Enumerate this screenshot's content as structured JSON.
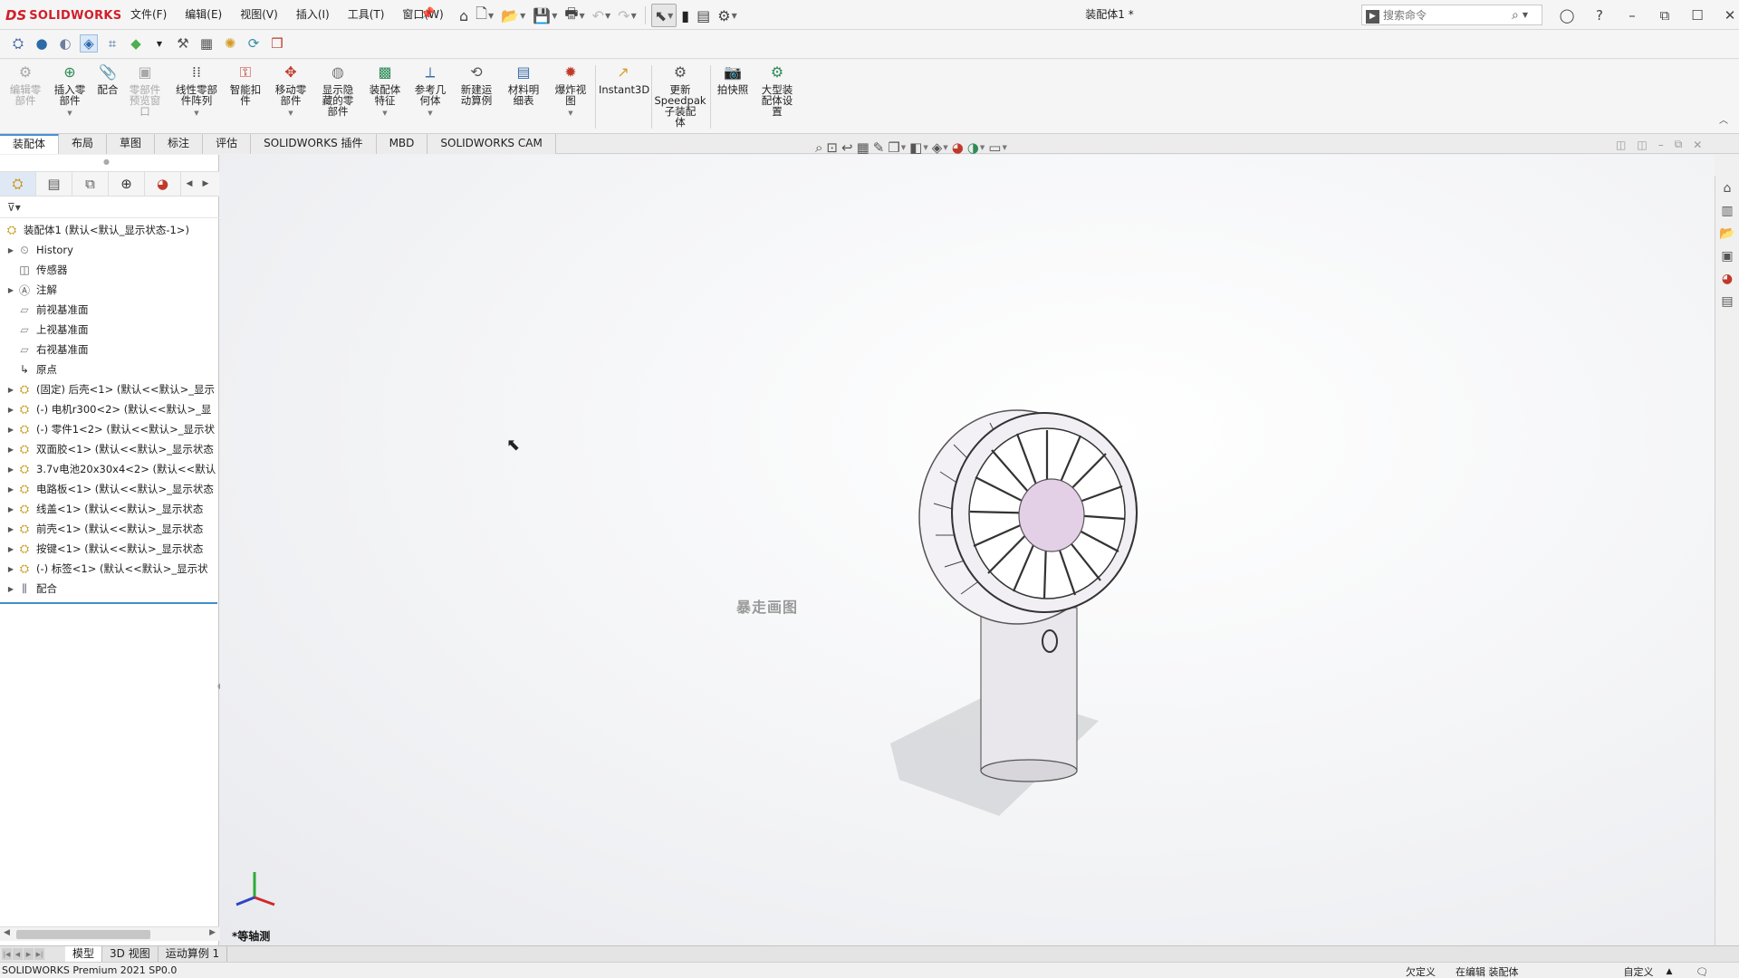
{
  "app": {
    "logo_ds": "DS",
    "logo_text": "SOLIDWORKS",
    "document_title": "装配体1 *",
    "brand_color": "#d11f2a"
  },
  "menu": [
    {
      "label": "文件(F)"
    },
    {
      "label": "编辑(E)"
    },
    {
      "label": "视图(V)"
    },
    {
      "label": "插入(I)"
    },
    {
      "label": "工具(T)"
    },
    {
      "label": "窗口(W)"
    }
  ],
  "search": {
    "placeholder": "搜索命令"
  },
  "commands": [
    {
      "label": "编辑零\n部件",
      "icon": "edit-component-icon",
      "enabled": false
    },
    {
      "label": "插入零\n部件",
      "icon": "insert-component-icon",
      "enabled": true
    },
    {
      "label": "配合",
      "icon": "mate-icon",
      "enabled": true
    },
    {
      "label": "零部件\n预览窗\n口",
      "icon": "component-preview-icon",
      "enabled": false
    },
    {
      "label": "线性零部\n件阵列",
      "icon": "linear-pattern-icon",
      "enabled": true
    },
    {
      "label": "智能扣\n件",
      "icon": "smart-fastener-icon",
      "enabled": true
    },
    {
      "label": "移动零\n部件",
      "icon": "move-component-icon",
      "enabled": true
    },
    {
      "label": "显示隐\n藏的零\n部件",
      "icon": "show-hidden-icon",
      "enabled": true
    },
    {
      "label": "装配体\n特征",
      "icon": "assembly-feature-icon",
      "enabled": true
    },
    {
      "label": "参考几\n何体",
      "icon": "reference-geometry-icon",
      "enabled": true
    },
    {
      "label": "新建运\n动算例",
      "icon": "new-motion-study-icon",
      "enabled": true
    },
    {
      "label": "材料明\n细表",
      "icon": "bom-icon",
      "enabled": true
    },
    {
      "label": "爆炸视\n图",
      "icon": "exploded-view-icon",
      "enabled": true
    },
    {
      "label": "Instant3D",
      "icon": "instant3d-icon",
      "enabled": true
    },
    {
      "label": "更新\nSpeedpak\n子装配\n体",
      "icon": "speedpak-icon",
      "enabled": true
    },
    {
      "label": "拍快照",
      "icon": "snapshot-icon",
      "enabled": true
    },
    {
      "label": "大型装\n配体设\n置",
      "icon": "large-assembly-icon",
      "enabled": true
    }
  ],
  "tabs": [
    {
      "label": "装配体",
      "active": true
    },
    {
      "label": "布局"
    },
    {
      "label": "草图"
    },
    {
      "label": "标注"
    },
    {
      "label": "评估"
    },
    {
      "label": "SOLIDWORKS 插件"
    },
    {
      "label": "MBD"
    },
    {
      "label": "SOLIDWORKS CAM"
    }
  ],
  "tree": {
    "root": "装配体1 (默认<默认_显示状态-1>)",
    "items": [
      {
        "label": "History",
        "icon": "history-icon",
        "expandable": true
      },
      {
        "label": "传感器",
        "icon": "sensor-icon",
        "expandable": false
      },
      {
        "label": "注解",
        "icon": "annotation-icon",
        "expandable": true
      },
      {
        "label": "前视基准面",
        "icon": "plane-icon",
        "expandable": false
      },
      {
        "label": "上视基准面",
        "icon": "plane-icon",
        "expandable": false
      },
      {
        "label": "右视基准面",
        "icon": "plane-icon",
        "expandable": false
      },
      {
        "label": "原点",
        "icon": "origin-icon",
        "expandable": false
      },
      {
        "label": "(固定) 后壳<1> (默认<<默认>_显示",
        "icon": "part-icon",
        "expandable": true
      },
      {
        "label": "(-) 电机r300<2> (默认<<默认>_显",
        "icon": "part-icon",
        "expandable": true
      },
      {
        "label": "(-) 零件1<2> (默认<<默认>_显示状",
        "icon": "part-icon",
        "expandable": true
      },
      {
        "label": "双面胶<1> (默认<<默认>_显示状态",
        "icon": "part-icon",
        "expandable": true
      },
      {
        "label": "3.7v电池20x30x4<2> (默认<<默认",
        "icon": "part-icon",
        "expandable": true
      },
      {
        "label": "电路板<1> (默认<<默认>_显示状态",
        "icon": "part-icon",
        "expandable": true
      },
      {
        "label": "线盖<1> (默认<<默认>_显示状态",
        "icon": "part-icon",
        "expandable": true
      },
      {
        "label": "前壳<1> (默认<<默认>_显示状态",
        "icon": "part-icon",
        "expandable": true
      },
      {
        "label": "按键<1> (默认<<默认>_显示状态",
        "icon": "part-icon",
        "expandable": true
      },
      {
        "label": "(-) 标签<1> (默认<<默认>_显示状",
        "icon": "part-icon",
        "expandable": true
      },
      {
        "label": "配合",
        "icon": "mates-folder-icon",
        "expandable": true
      }
    ]
  },
  "viewport": {
    "watermark": "暴走画图",
    "view_name": "*等轴测"
  },
  "bottom_tabs": [
    {
      "label": "模型",
      "active": true
    },
    {
      "label": "3D 视图"
    },
    {
      "label": "运动算例 1"
    }
  ],
  "status": {
    "app_version": "SOLIDWORKS Premium 2021 SP0.0",
    "state": "欠定义",
    "editing": "在编辑 装配体",
    "custom": "自定义"
  }
}
